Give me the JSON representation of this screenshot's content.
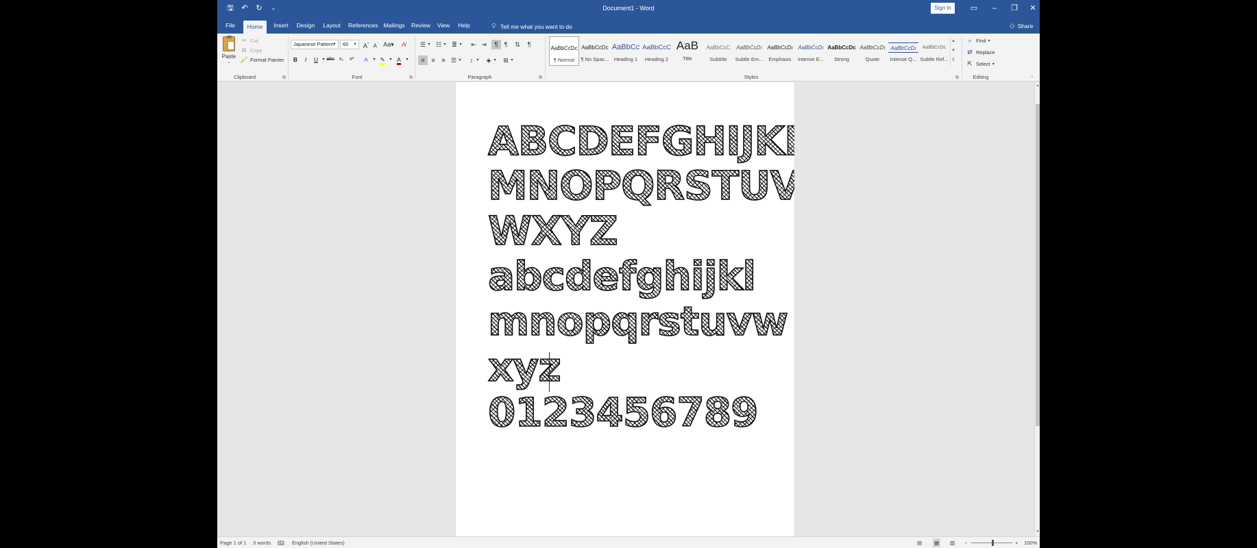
{
  "window": {
    "title": "Document1 - Word",
    "sign_in": "Sign in"
  },
  "tabs": [
    {
      "label": "File"
    },
    {
      "label": "Home"
    },
    {
      "label": "Insert"
    },
    {
      "label": "Design"
    },
    {
      "label": "Layout"
    },
    {
      "label": "References"
    },
    {
      "label": "Mailings"
    },
    {
      "label": "Review"
    },
    {
      "label": "View"
    },
    {
      "label": "Help"
    }
  ],
  "tell_me": "Tell me what you want to do",
  "share": "Share",
  "clipboard": {
    "label": "Clipboard",
    "paste": "Paste",
    "cut": "Cut",
    "copy": "Copy",
    "format_painter": "Format Painter"
  },
  "font": {
    "label": "Font",
    "name": "Japanese Pattern",
    "size": "60",
    "bold": "B",
    "italic": "I",
    "underline": "U"
  },
  "paragraph": {
    "label": "Paragraph"
  },
  "styles": {
    "label": "Styles",
    "items": [
      {
        "preview": "AaBbCcDc",
        "name": "¶ Normal"
      },
      {
        "preview": "AaBbCcDc",
        "name": "¶ No Spac..."
      },
      {
        "preview": "AaBbCc",
        "name": "Heading 1"
      },
      {
        "preview": "AaBbCcC",
        "name": "Heading 2"
      },
      {
        "preview": "AaB",
        "name": "Title"
      },
      {
        "preview": "AaBbCcC",
        "name": "Subtitle"
      },
      {
        "preview": "AaBbCcDı",
        "name": "Subtle Em..."
      },
      {
        "preview": "AaBbCcDı",
        "name": "Emphasis"
      },
      {
        "preview": "AaBbCcDı",
        "name": "Intense E..."
      },
      {
        "preview": "AaBbCcDc",
        "name": "Strong"
      },
      {
        "preview": "AaBbCcDı",
        "name": "Quote"
      },
      {
        "preview": "AaBbCcDı",
        "name": "Intense Q..."
      },
      {
        "preview": "AaBbCcDc",
        "name": "Subtle Ref..."
      }
    ]
  },
  "editing": {
    "label": "Editing",
    "find": "Find",
    "replace": "Replace",
    "select": "Select"
  },
  "document": {
    "lines": [
      "ABCDEFGHIJKL",
      "MNOPQRSTUV",
      "WXYZ",
      "abcdefghijkl",
      "mnopqrstuvw",
      "xyz",
      "0123456789"
    ]
  },
  "status": {
    "page": "Page 1 of 1",
    "words": "3 words",
    "language": "English (United States)",
    "zoom": "100%"
  },
  "colors": {
    "title_bar": "#2b579a",
    "ribbon": "#f3f3f3",
    "workspace": "#e6e6e6",
    "font_color_swatch": "#c00000",
    "highlight_swatch": "#ffff00"
  }
}
